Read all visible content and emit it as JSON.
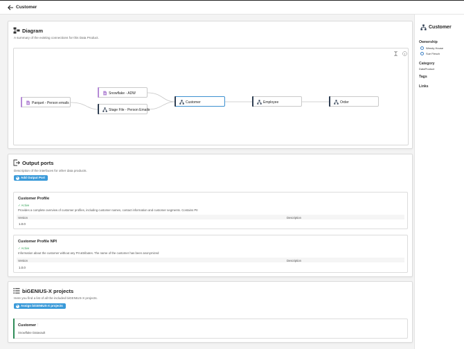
{
  "header": {
    "title": "Customer"
  },
  "diagram": {
    "title": "Diagram",
    "description": "A summary of the existing connections for this Data Product.",
    "nodes": [
      {
        "label": "Parquet - Person emails",
        "color": "#b58ad6"
      },
      {
        "label": "Snowflake - ADW",
        "color": "#b58ad6"
      },
      {
        "label": "Stage File - Person Emails",
        "color": "#2f3e52"
      },
      {
        "label": "Customer",
        "color": "#2f3e52"
      },
      {
        "label": "Employee",
        "color": "#2f3e52"
      },
      {
        "label": "Order",
        "color": "#2f3e52"
      }
    ]
  },
  "output_ports": {
    "title": "Output ports",
    "description": "Description of the interfaces for other data products.",
    "add_label": "Add Output Port",
    "ports": [
      {
        "name": "Customer Profile",
        "status": "✓ Active",
        "description": "Provides a complete overview of customer profiles, including customer names, contact information and customer segments. Contains PII",
        "col_version": "Version",
        "col_description": "Description",
        "version": "1.0.0"
      },
      {
        "name": "Customer Profile NPI",
        "status": "✓ Active",
        "description": "Information about the customer without any PII attributes. The name of the customer has been anonymized",
        "col_version": "Version",
        "col_description": "Description",
        "version": "1.0.0"
      }
    ]
  },
  "projects": {
    "title": "biGENIUS-X projects",
    "description": "Here you find a list of all the included biGENIUS-X projects.",
    "assign_label": "Assign biGENIUS-X projects",
    "items": [
      {
        "name": "Customer",
        "subtitle": "Snowflake Datavault",
        "color": "#2e8b57"
      }
    ]
  },
  "side": {
    "title": "Customer",
    "ownership_label": "Ownership",
    "owners": [
      "Wendy House",
      "Sue Flesch"
    ],
    "category_label": "Category",
    "category_value": "DataProduct",
    "tags_label": "Tags",
    "links_label": "Links"
  },
  "colors": {
    "accent": "#3a9ad9",
    "active": "#3aa35c",
    "node_dark": "#2f3e52",
    "node_purple": "#b58ad6"
  }
}
